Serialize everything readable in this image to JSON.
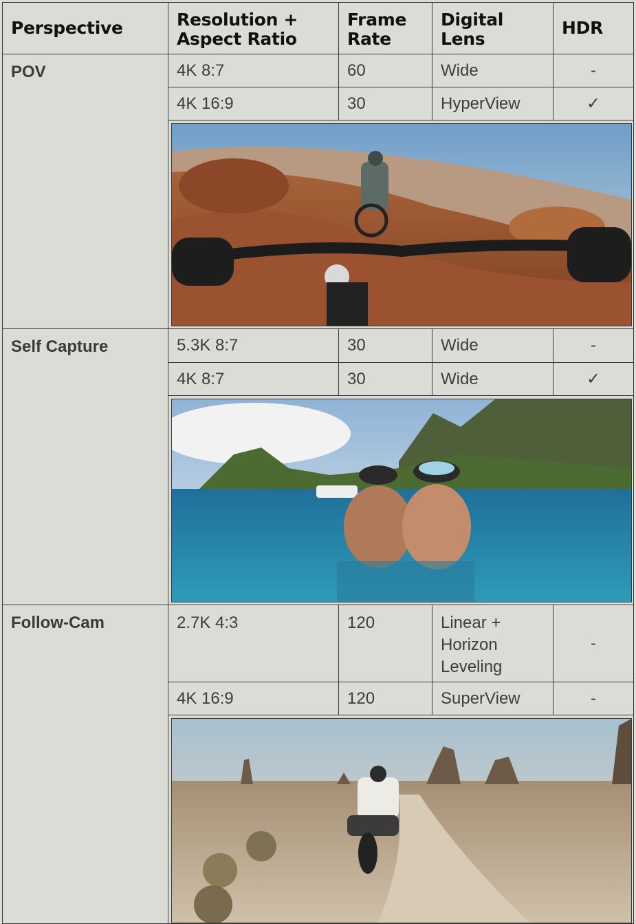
{
  "headers": {
    "perspective": "Perspective",
    "resolution_l1": "Resolution +",
    "resolution_l2": "Aspect Ratio",
    "frame_l1": "Frame",
    "frame_l2": "Rate",
    "lens_l1": "Digital",
    "lens_l2": "Lens",
    "hdr": "HDR"
  },
  "groups": [
    {
      "perspective": "POV",
      "rows": [
        {
          "resolution": "4K 8:7",
          "frame_rate": "60",
          "lens": "Wide",
          "hdr": "-"
        },
        {
          "resolution": "4K 16:9",
          "frame_rate": "30",
          "lens": "HyperView",
          "hdr": "✓"
        }
      ],
      "photo": "mountain-bike-pov-photo"
    },
    {
      "perspective": "Self Capture",
      "rows": [
        {
          "resolution": "5.3K 8:7",
          "frame_rate": "30",
          "lens": "Wide",
          "hdr": "-"
        },
        {
          "resolution": "4K 8:7",
          "frame_rate": "30",
          "lens": "Wide",
          "hdr": "✓"
        }
      ],
      "photo": "snorkel-selfie-photo"
    },
    {
      "perspective": "Follow-Cam",
      "rows": [
        {
          "resolution": "2.7K 4:3",
          "frame_rate": "120",
          "lens_l1": "Linear +",
          "lens_l2": "Horizon",
          "lens_l3": "Leveling",
          "hdr": "-"
        },
        {
          "resolution": "4K 16:9",
          "frame_rate": "120",
          "lens": "SuperView",
          "hdr": "-"
        }
      ],
      "photo": "desert-motorbike-photo"
    }
  ]
}
